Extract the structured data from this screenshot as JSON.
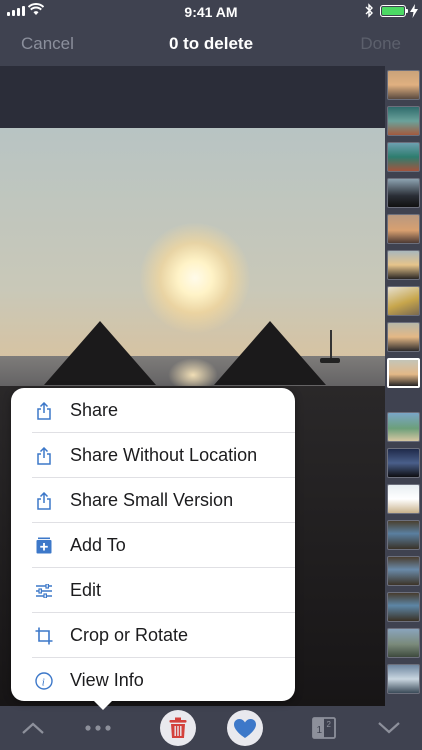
{
  "status_bar": {
    "time": "9:41 AM"
  },
  "nav": {
    "cancel": "Cancel",
    "title": "0 to delete",
    "done": "Done"
  },
  "menu": {
    "items": [
      {
        "label": "Share",
        "icon": "share-icon"
      },
      {
        "label": "Share Without Location",
        "icon": "share-icon"
      },
      {
        "label": "Share Small Version",
        "icon": "share-icon"
      },
      {
        "label": "Add To",
        "icon": "add-to-album-icon"
      },
      {
        "label": "Edit",
        "icon": "sliders-icon"
      },
      {
        "label": "Crop or Rotate",
        "icon": "crop-icon"
      },
      {
        "label": "View Info",
        "icon": "info-icon"
      }
    ]
  },
  "toolbar": {
    "compare_badge": "1 2",
    "icons": [
      "chevron-up-icon",
      "more-icon",
      "trash-icon",
      "heart-icon",
      "compare-icon",
      "chevron-down-icon"
    ]
  },
  "colors": {
    "accent": "#3d78c9",
    "delete": "#d4413c",
    "battery": "#4cd964",
    "background": "#3f4250"
  }
}
